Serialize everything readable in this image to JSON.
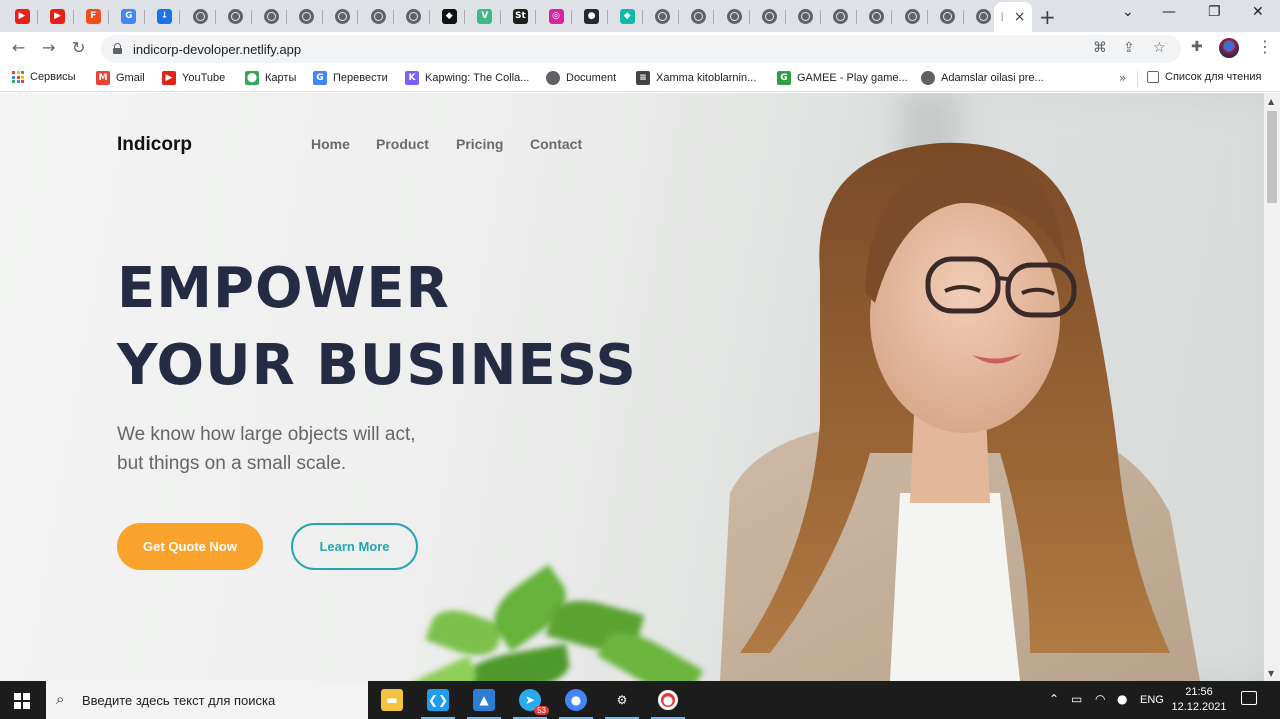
{
  "browser": {
    "tabs": [
      {
        "icon": "youtube-icon",
        "color": "#e62117",
        "glyph": "▶"
      },
      {
        "icon": "youtube-icon",
        "color": "#e62117",
        "glyph": "▶"
      },
      {
        "icon": "figma-icon",
        "color": "#f24e1e",
        "glyph": "F"
      },
      {
        "icon": "google-translate-icon",
        "color": "#4285f4",
        "glyph": "G"
      },
      {
        "icon": "download-icon",
        "color": "#1a73e8",
        "glyph": "↓"
      },
      {
        "icon": "globe-icon"
      },
      {
        "icon": "globe-icon"
      },
      {
        "icon": "globe-icon"
      },
      {
        "icon": "globe-icon"
      },
      {
        "icon": "globe-icon"
      },
      {
        "icon": "globe-icon"
      },
      {
        "icon": "globe-icon"
      },
      {
        "icon": "codepen-icon",
        "color": "#111111",
        "glyph": "◆"
      },
      {
        "icon": "vue-icon",
        "color": "#41b883",
        "glyph": "V"
      },
      {
        "icon": "sololearn-icon",
        "color": "#1f1f1f",
        "glyph": "St"
      },
      {
        "icon": "instagram-icon",
        "color": "#d6249f",
        "glyph": "◎"
      },
      {
        "icon": "github-icon",
        "color": "#24292e",
        "glyph": "●"
      },
      {
        "icon": "diamond-icon",
        "color": "#14b8a6",
        "glyph": "◆"
      },
      {
        "icon": "globe-icon"
      },
      {
        "icon": "globe-icon"
      },
      {
        "icon": "globe-icon"
      },
      {
        "icon": "globe-icon"
      },
      {
        "icon": "globe-icon"
      },
      {
        "icon": "globe-icon"
      },
      {
        "icon": "globe-icon"
      },
      {
        "icon": "globe-icon"
      },
      {
        "icon": "globe-icon"
      },
      {
        "icon": "globe-icon"
      }
    ],
    "active_tab_label": "I",
    "new_tab_glyph": "+",
    "window_controls": {
      "dropdown": "⌄",
      "minimize": "—",
      "maximize": "❐",
      "close": "✕"
    },
    "url": "indicorp-devoloper.netlify.app",
    "bookmarks": [
      {
        "label": "Сервисы",
        "icon": "apps-grid-icon"
      },
      {
        "label": "Gmail",
        "icon": "gmail-icon",
        "color": "#ea4335",
        "glyph": "M"
      },
      {
        "label": "YouTube",
        "icon": "youtube-icon",
        "color": "#e62117",
        "glyph": "▶"
      },
      {
        "label": "Карты",
        "icon": "maps-pin-icon",
        "color": "#34a853",
        "glyph": "⬤"
      },
      {
        "label": "Перевести",
        "icon": "google-translate-icon",
        "color": "#4285f4",
        "glyph": "G"
      },
      {
        "label": "Kapwing: The Colla...",
        "icon": "kapwing-icon",
        "color": "#7b61ff",
        "glyph": "K"
      },
      {
        "label": "Document",
        "icon": "globe-icon"
      },
      {
        "label": "Xamma kitoblarnin...",
        "icon": "books-icon",
        "color": "#444444",
        "glyph": "≡"
      },
      {
        "label": "GAMEE - Play game...",
        "icon": "gamee-icon",
        "color": "#2ea043",
        "glyph": "G"
      },
      {
        "label": "Adamslar oilasi pre...",
        "icon": "globe-icon"
      }
    ],
    "bookmarks_overflow": "»",
    "reading_list_label": "Список для чтения"
  },
  "site": {
    "brand": "Indicorp",
    "nav": [
      "Home",
      "Product",
      "Pricing",
      "Contact"
    ],
    "hero_title_line1": "EMPOWER",
    "hero_title_line2": "YOUR BUSINESS",
    "hero_sub_line1": "We know how large objects will act,",
    "hero_sub_line2": "but things on a small scale.",
    "cta_primary": "Get Quote Now",
    "cta_secondary": "Learn More",
    "colors": {
      "accent": "#f9a32c",
      "teal": "#23a6b0",
      "heading": "#252b42"
    }
  },
  "taskbar": {
    "search_placeholder": "Введите здесь текст для поиска",
    "apps": [
      {
        "icon": "file-explorer-icon",
        "color": "#f5c242",
        "glyph": "▬"
      },
      {
        "icon": "vscode-icon",
        "color": "#1f9cf0",
        "glyph": "❮❯"
      },
      {
        "icon": "photos-icon",
        "color": "#2d7dd2",
        "glyph": "▲"
      },
      {
        "icon": "telegram-icon",
        "color": "#2aabee",
        "glyph": "➤",
        "badge": "53"
      },
      {
        "icon": "chrome-icon",
        "color": "#4285f4",
        "glyph": "●"
      },
      {
        "icon": "settings-gear-icon",
        "color": "#1c1c1c",
        "glyph": "⚙"
      },
      {
        "icon": "record-icon",
        "color": "#e53935",
        "glyph": "●"
      }
    ],
    "language": "ENG",
    "time": "21:56",
    "date": "12.12.2021"
  }
}
